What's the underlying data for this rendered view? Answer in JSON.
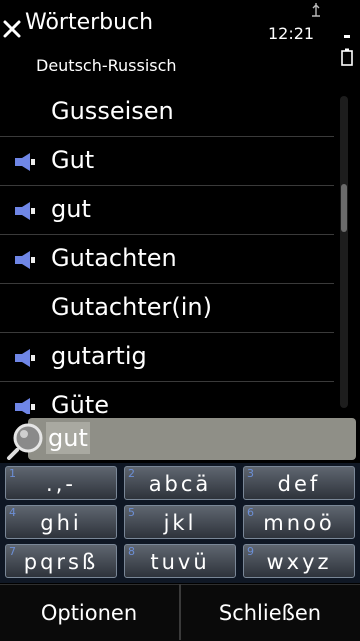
{
  "header": {
    "title": "Wörterbuch",
    "subtitle": "Deutsch-Russisch",
    "clock": "12:21"
  },
  "list": {
    "items": [
      {
        "label": "Gusseisen",
        "audio": false
      },
      {
        "label": "Gut",
        "audio": true
      },
      {
        "label": "gut",
        "audio": true
      },
      {
        "label": "Gutachten",
        "audio": true
      },
      {
        "label": "Gutachter(in)",
        "audio": false
      },
      {
        "label": "gutartig",
        "audio": true
      },
      {
        "label": "Güte",
        "audio": true
      }
    ]
  },
  "search": {
    "value": "gut",
    "icon": "magnifier-icon"
  },
  "keypad": {
    "keys": [
      {
        "num": "1",
        "label": ".,-"
      },
      {
        "num": "2",
        "label": "abcä"
      },
      {
        "num": "3",
        "label": "def"
      },
      {
        "num": "4",
        "label": "ghi"
      },
      {
        "num": "5",
        "label": "jkl"
      },
      {
        "num": "6",
        "label": "mnoö"
      },
      {
        "num": "7",
        "label": "pqrsß"
      },
      {
        "num": "8",
        "label": "tuvü"
      },
      {
        "num": "9",
        "label": "wxyz"
      }
    ]
  },
  "softkeys": {
    "left": "Optionen",
    "right": "Schließen"
  },
  "colors": {
    "background": "#000000",
    "speaker_icon": "#6f86e6",
    "keypad_number": "#6c8fd6",
    "search_box": "#8f8f87"
  }
}
